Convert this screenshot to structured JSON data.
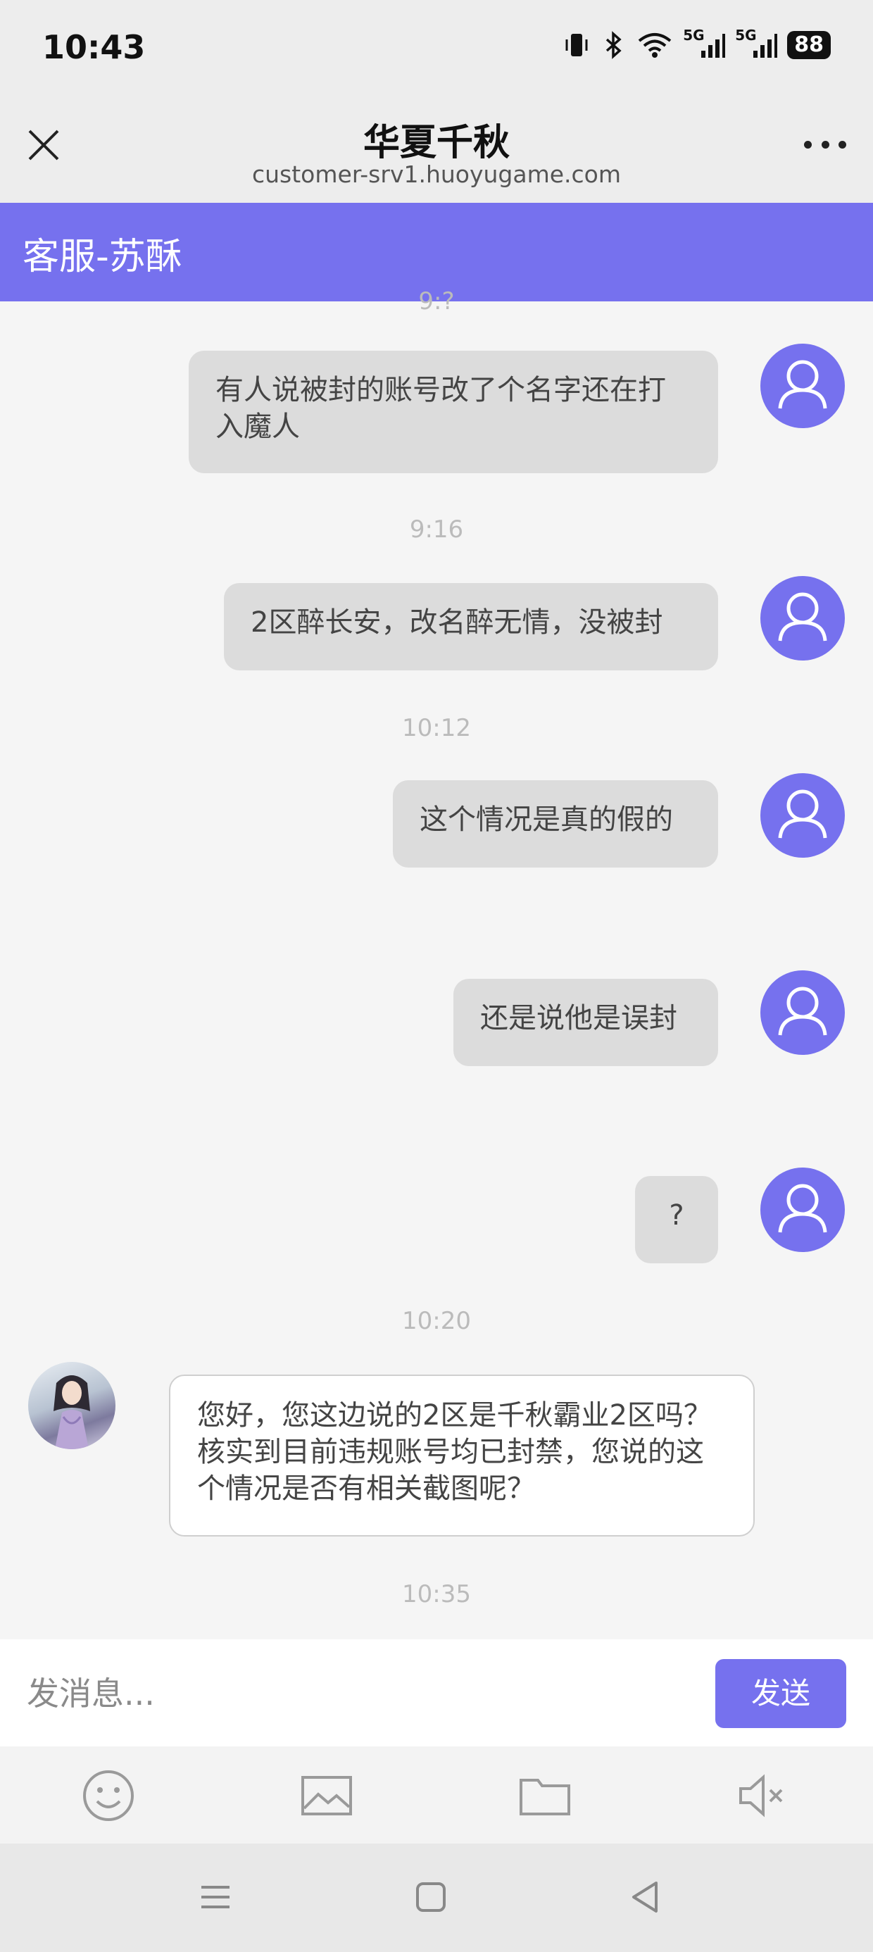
{
  "status_bar": {
    "time": "10:43",
    "icons": [
      "vibrate-icon",
      "bluetooth-icon",
      "wifi-icon",
      "signal-5g-icon",
      "signal-5g-icon"
    ],
    "network_label_1": "5G",
    "network_label_2": "5G",
    "battery": "88"
  },
  "nav": {
    "title": "华夏千秋",
    "url": "customer-srv1.huoyugame.com",
    "close_icon": "close-icon",
    "more_icon": "more-icon"
  },
  "service": {
    "title": "客服-苏酥",
    "accent": "#7671ee"
  },
  "chat": {
    "partial_time": "9:?",
    "messages": [
      {
        "side": "user",
        "text": "有人说被封的账号改了个名字还在打入魔人"
      },
      {
        "time": "9:16"
      },
      {
        "side": "user",
        "text": "2区醉长安，改名醉无情，没被封"
      },
      {
        "time": "10:12"
      },
      {
        "side": "user",
        "text": "这个情况是真的假的"
      },
      {
        "side": "user",
        "text": "还是说他是误封"
      },
      {
        "side": "user",
        "text": "?"
      },
      {
        "time": "10:20"
      },
      {
        "side": "agent",
        "text": "您好，您这边说的2区是千秋霸业2区吗？核实到目前违规账号均已封禁，您说的这个情况是否有相关截图呢？"
      },
      {
        "time": "10:35"
      }
    ]
  },
  "input": {
    "placeholder": "发消息...",
    "send_label": "发送"
  },
  "toolbar": {
    "items": [
      "emoji-icon",
      "image-icon",
      "folder-icon",
      "mute-icon"
    ]
  }
}
